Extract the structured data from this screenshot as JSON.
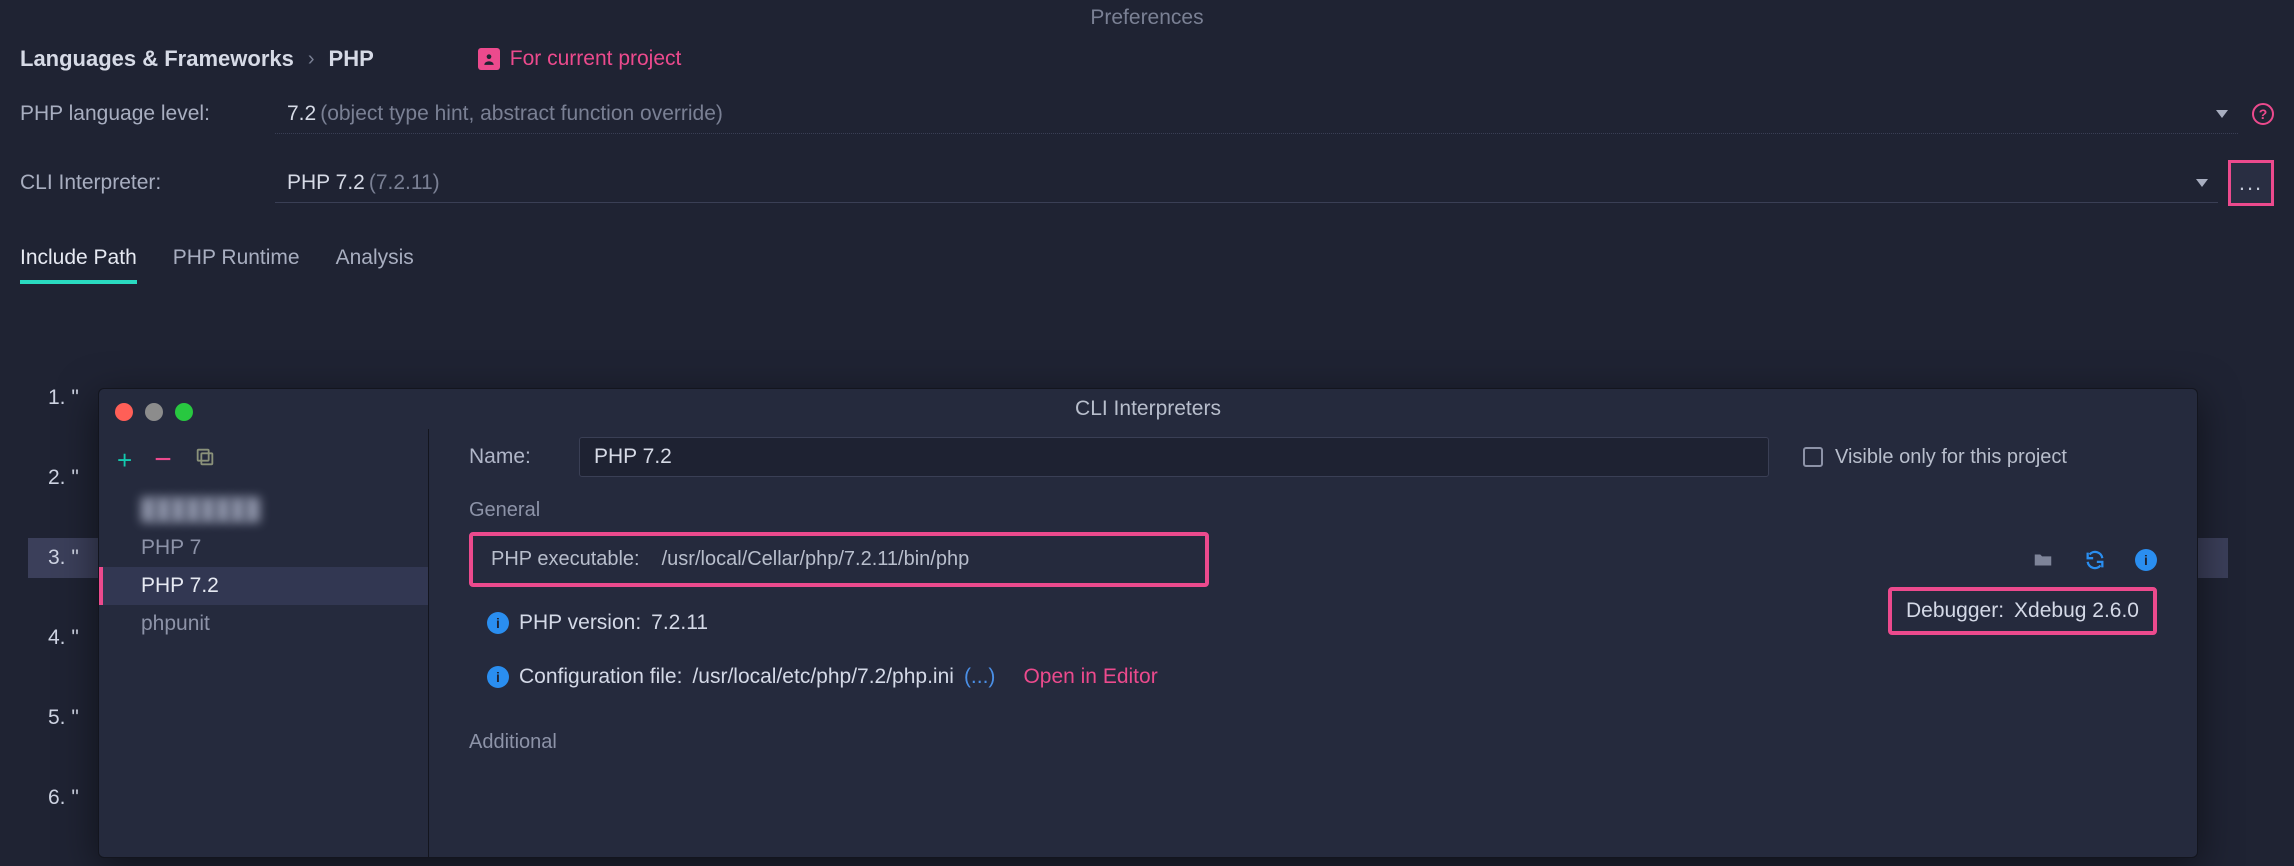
{
  "title": "Preferences",
  "breadcrumb": {
    "seg1": "Languages & Frameworks",
    "sep": "›",
    "seg2": "PHP"
  },
  "project_scope": "For current project",
  "fields": {
    "lang_level_label": "PHP language level:",
    "lang_level_value": "7.2",
    "lang_level_hint": "(object type hint, abstract function override)",
    "cli_label": "CLI Interpreter:",
    "cli_value": "PHP 7.2",
    "cli_hint": "(7.2.11)"
  },
  "tabs": {
    "t1": "Include Path",
    "t2": "PHP Runtime",
    "t3": "Analysis"
  },
  "list": {
    "n1": "1. \"",
    "n2": "2. \"",
    "n3": "3. \"",
    "n4": "4. \"",
    "n5": "5. \"",
    "n6": "6. \""
  },
  "dialog": {
    "title": "CLI Interpreters",
    "interpreters": {
      "i0": "████████",
      "i1": "PHP 7",
      "i2": "PHP 7.2",
      "i3": "phpunit"
    },
    "name_label": "Name:",
    "name_value": "PHP 7.2",
    "visible_label": "Visible only for this project",
    "general_label": "General",
    "exec_label": "PHP executable:",
    "exec_value": "/usr/local/Cellar/php/7.2.11/bin/php",
    "phpver_label": "PHP version:",
    "phpver_value": "7.2.11",
    "debugger_label": "Debugger:",
    "debugger_value": "Xdebug 2.6.0",
    "cfg_label": "Configuration file:",
    "cfg_value": "/usr/local/etc/php/7.2/php.ini",
    "ellipsis": "(...)",
    "open_editor": "Open in Editor",
    "additional_label": "Additional"
  }
}
